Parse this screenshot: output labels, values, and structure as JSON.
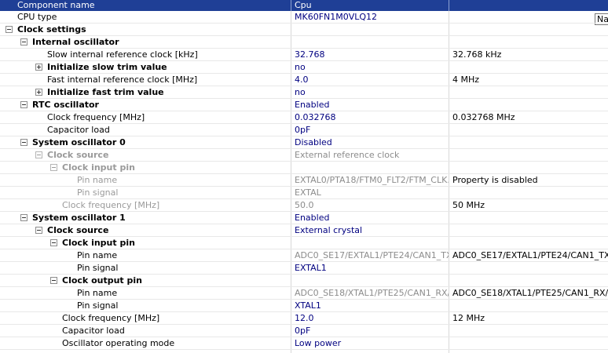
{
  "header": {
    "col1": "Component name",
    "col2": "Cpu",
    "col3": ""
  },
  "tooltip": "Na",
  "rows": [
    {
      "id": "cpu-type",
      "name": "CPU type",
      "value": "MK60FN1M0VLQ12",
      "extra": ""
    },
    {
      "id": "clock-settings",
      "name": "Clock settings",
      "value": "",
      "extra": ""
    },
    {
      "id": "internal-oscillator",
      "name": "Internal oscillator",
      "value": "",
      "extra": ""
    },
    {
      "id": "slow-irc",
      "name": "Slow internal reference clock [kHz]",
      "value": "32.768",
      "extra": "32.768 kHz"
    },
    {
      "id": "init-slow-trim",
      "name": "Initialize slow trim value",
      "value": "no",
      "extra": ""
    },
    {
      "id": "fast-irc",
      "name": "Fast internal reference clock [MHz]",
      "value": "4.0",
      "extra": "4 MHz"
    },
    {
      "id": "init-fast-trim",
      "name": "Initialize fast trim value",
      "value": "no",
      "extra": ""
    },
    {
      "id": "rtc-oscillator",
      "name": "RTC oscillator",
      "value": "Enabled",
      "extra": ""
    },
    {
      "id": "rtc-clock-frequency",
      "name": "Clock frequency [MHz]",
      "value": "0.032768",
      "extra": "0.032768 MHz"
    },
    {
      "id": "rtc-capacitor-load",
      "name": "Capacitor load",
      "value": "0pF",
      "extra": ""
    },
    {
      "id": "system-oscillator-0",
      "name": "System oscillator 0",
      "value": "Disabled",
      "extra": ""
    },
    {
      "id": "osc0-clock-source",
      "name": "Clock source",
      "value": "External reference clock",
      "extra": ""
    },
    {
      "id": "osc0-clock-input-pin",
      "name": "Clock input pin",
      "value": "",
      "extra": ""
    },
    {
      "id": "osc0-pin-name",
      "name": "Pin name",
      "value": "EXTAL0/PTA18/FTM0_FLT2/FTM_CLK...",
      "extra": "Property is disabled"
    },
    {
      "id": "osc0-pin-signal",
      "name": "Pin signal",
      "value": "EXTAL",
      "extra": ""
    },
    {
      "id": "osc0-clock-frequency",
      "name": "Clock frequency [MHz]",
      "value": "50.0",
      "extra": "50 MHz"
    },
    {
      "id": "system-oscillator-1",
      "name": "System oscillator 1",
      "value": "Enabled",
      "extra": ""
    },
    {
      "id": "osc1-clock-source",
      "name": "Clock source",
      "value": "External crystal",
      "extra": ""
    },
    {
      "id": "osc1-clock-input-pin",
      "name": "Clock input pin",
      "value": "",
      "extra": ""
    },
    {
      "id": "osc1-input-pin-name",
      "name": "Pin name",
      "value": "ADC0_SE17/EXTAL1/PTE24/CAN1_TX...",
      "extra": "ADC0_SE17/EXTAL1/PTE24/CAN1_TX..."
    },
    {
      "id": "osc1-input-pin-signal",
      "name": "Pin signal",
      "value": "EXTAL1",
      "extra": ""
    },
    {
      "id": "osc1-clock-output-pin",
      "name": "Clock output pin",
      "value": "",
      "extra": ""
    },
    {
      "id": "osc1-output-pin-name",
      "name": "Pin name",
      "value": "ADC0_SE18/XTAL1/PTE25/CAN1_RX/...",
      "extra": "ADC0_SE18/XTAL1/PTE25/CAN1_RX/..."
    },
    {
      "id": "osc1-output-pin-signal",
      "name": "Pin signal",
      "value": "XTAL1",
      "extra": ""
    },
    {
      "id": "osc1-clock-frequency",
      "name": "Clock frequency [MHz]",
      "value": "12.0",
      "extra": "12 MHz"
    },
    {
      "id": "osc1-capacitor-load",
      "name": "Capacitor load",
      "value": "0pF",
      "extra": ""
    },
    {
      "id": "osc1-operating-mode",
      "name": "Oscillator operating mode",
      "value": "Low power",
      "extra": ""
    },
    {
      "id": "next-row-partial",
      "name": "",
      "value": "",
      "extra": ""
    }
  ],
  "colors": {
    "header_bg": "#1f3f96",
    "value_text": "#000080",
    "disabled_text": "#8c8c8c"
  }
}
